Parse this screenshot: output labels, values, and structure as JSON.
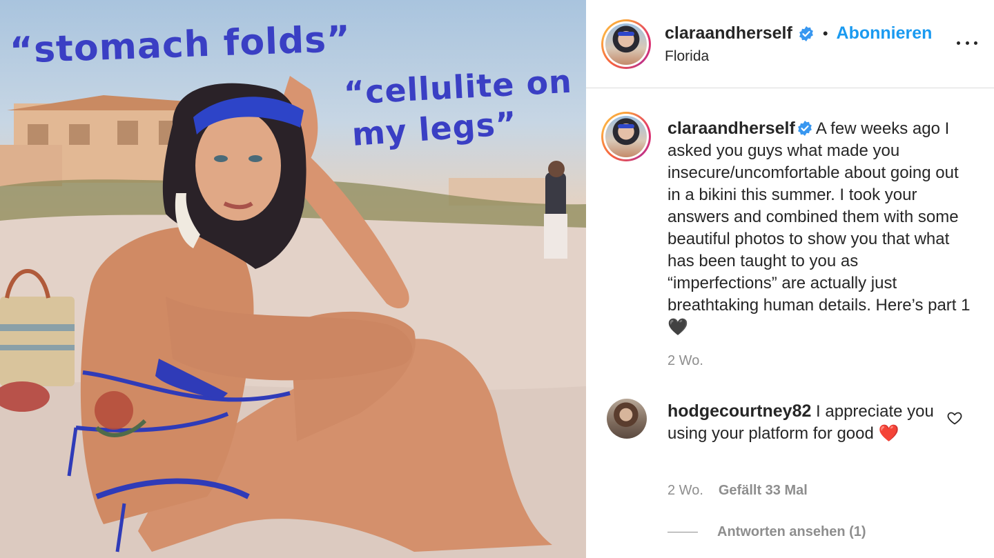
{
  "photo": {
    "text_lines": [
      "“stomach folds”",
      "“cellulite on",
      "my legs”"
    ]
  },
  "post": {
    "username": "claraandherself",
    "separator": "•",
    "follow_label": "Abonnieren",
    "location": "Florida",
    "caption_text": "A few weeks ago I asked you guys what made you insecure/uncomfortable about going out in a bikini this summer. I took your answers and combined them with some beautiful photos to show you that what has been taught to you as “imperfections” are actually just breathtaking human details. Here’s part 1 ",
    "caption_emoji": "🖤",
    "caption_time": "2 Wo."
  },
  "comment": {
    "username": "hodgecourtney82",
    "text": "I appreciate you using your platform for good ",
    "emoji": "❤️",
    "time": "2 Wo.",
    "likes": "Gefällt 33 Mal",
    "view_replies": "Antworten ansehen (1)"
  },
  "colors": {
    "link_blue": "#1a9af0",
    "verified_blue": "#3897f0",
    "handwriting": "#3a3fc4",
    "meta_gray": "#8e8e8e"
  },
  "icons": [
    "verified-badge-icon",
    "more-options-icon",
    "heart-icon"
  ]
}
